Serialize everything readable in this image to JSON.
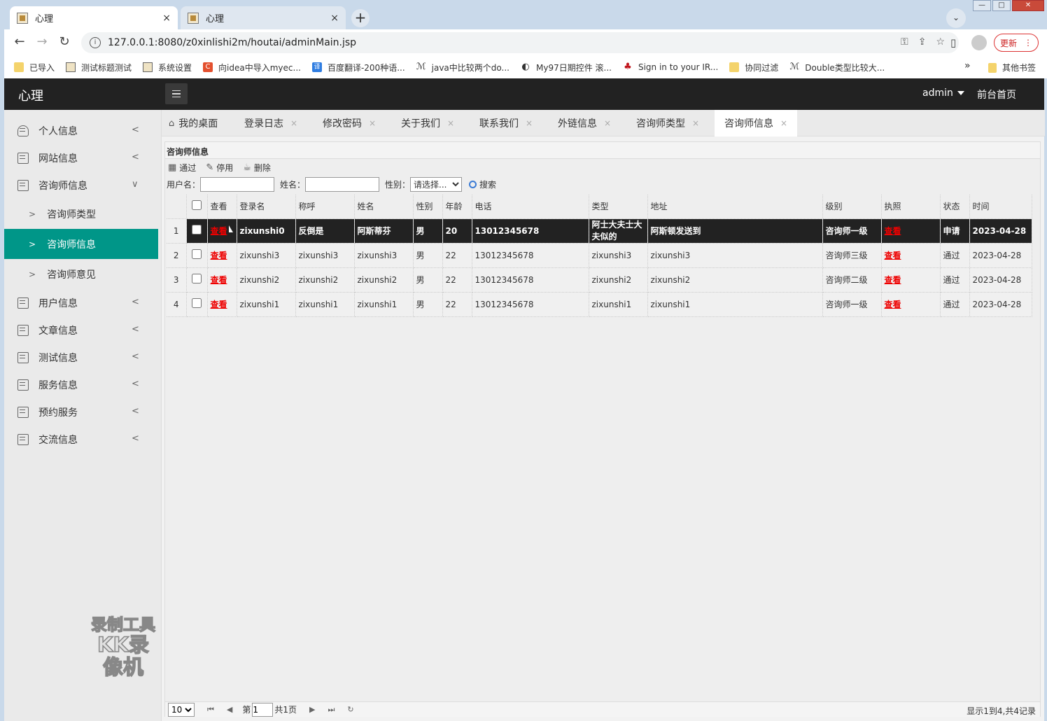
{
  "browser": {
    "tabs": [
      {
        "title": "心理",
        "close": "×"
      },
      {
        "title": "心理",
        "close": "×"
      }
    ],
    "new_tab": "+",
    "url": "127.0.0.1:8080/z0xinlishi2m/houtai/adminMain.jsp",
    "update_label": "更新",
    "bookmarks": [
      {
        "label": "已导入",
        "icon": "folder-icon"
      },
      {
        "label": "测试标题测试",
        "icon": "image-icon"
      },
      {
        "label": "系统设置",
        "icon": "image-icon"
      },
      {
        "label": "向idea中导入myec...",
        "icon": "csdn-icon"
      },
      {
        "label": "百度翻译-200种语...",
        "icon": "translate-icon"
      },
      {
        "label": "java中比较两个do...",
        "icon": "link-icon"
      },
      {
        "label": "My97日期控件 滚...",
        "icon": "globe-icon"
      },
      {
        "label": "Sign in to your IR...",
        "icon": "maple-leaf-icon"
      },
      {
        "label": "协同过滤",
        "icon": "folder-icon"
      },
      {
        "label": "Double类型比较大...",
        "icon": "link-icon"
      }
    ],
    "bookmarks_more": "»",
    "other_bookmarks": "其他书签"
  },
  "header": {
    "logo": "心理",
    "user": "admin",
    "front_link": "前台首页"
  },
  "sidebar": {
    "items": [
      {
        "label": "个人信息",
        "arrow": "<"
      },
      {
        "label": "网站信息",
        "arrow": "<"
      },
      {
        "label": "咨询师信息",
        "arrow": "∨"
      },
      {
        "label": "用户信息",
        "arrow": "<"
      },
      {
        "label": "文章信息",
        "arrow": "<"
      },
      {
        "label": "测试信息",
        "arrow": "<"
      },
      {
        "label": "服务信息",
        "arrow": "<"
      },
      {
        "label": "预约服务",
        "arrow": "<"
      },
      {
        "label": "交流信息",
        "arrow": "<"
      }
    ],
    "subitems": [
      {
        "label": "咨询师类型",
        "arrow": ">"
      },
      {
        "label": "咨询师信息",
        "arrow": ">"
      },
      {
        "label": "咨询师意见",
        "arrow": ">"
      }
    ]
  },
  "page_tabs": [
    {
      "label": "我的桌面"
    },
    {
      "label": "登录日志",
      "close": "×"
    },
    {
      "label": "修改密码",
      "close": "×"
    },
    {
      "label": "关于我们",
      "close": "×"
    },
    {
      "label": "联系我们",
      "close": "×"
    },
    {
      "label": "外链信息",
      "close": "×"
    },
    {
      "label": "咨询师类型",
      "close": "×"
    },
    {
      "label": "咨询师信息",
      "close": "×"
    }
  ],
  "panel": {
    "title": "咨询师信息",
    "ops": {
      "approve": "通过",
      "disable": "停用",
      "delete": "删除"
    },
    "filters": {
      "username_label": "用户名：",
      "name_label": "姓名：",
      "gender_label": "性别：",
      "gender_selected": "请选择...",
      "search": "搜索"
    },
    "columns": [
      "",
      "",
      "查看",
      "登录名",
      "称呼",
      "姓名",
      "性别",
      "年龄",
      "电话",
      "类型",
      "地址",
      "级别",
      "执照",
      "状态",
      "时间"
    ],
    "rows": [
      {
        "n": "1",
        "view": "查看",
        "login": "zixunshi0",
        "nick": "反倒是",
        "name": "阿斯蒂芬",
        "gender": "男",
        "age": "20",
        "phone": "13012345678",
        "type": "阿士大夫士大夫似的",
        "addr": "阿斯顿发送到",
        "level": "咨询师一级",
        "license": "查看",
        "status": "申请",
        "time": "2023-04-28"
      },
      {
        "n": "2",
        "view": "查看",
        "login": "zixunshi3",
        "nick": "zixunshi3",
        "name": "zixunshi3",
        "gender": "男",
        "age": "22",
        "phone": "13012345678",
        "type": "zixunshi3",
        "addr": "zixunshi3",
        "level": "咨询师三级",
        "license": "查看",
        "status": "通过",
        "time": "2023-04-28"
      },
      {
        "n": "3",
        "view": "查看",
        "login": "zixunshi2",
        "nick": "zixunshi2",
        "name": "zixunshi2",
        "gender": "男",
        "age": "22",
        "phone": "13012345678",
        "type": "zixunshi2",
        "addr": "zixunshi2",
        "level": "咨询师二级",
        "license": "查看",
        "status": "通过",
        "time": "2023-04-28"
      },
      {
        "n": "4",
        "view": "查看",
        "login": "zixunshi1",
        "nick": "zixunshi1",
        "name": "zixunshi1",
        "gender": "男",
        "age": "22",
        "phone": "13012345678",
        "type": "zixunshi1",
        "addr": "zixunshi1",
        "level": "咨询师一级",
        "license": "查看",
        "status": "通过",
        "time": "2023-04-28"
      }
    ],
    "pager": {
      "page_size": "10",
      "page_prefix": "第",
      "page": "1",
      "page_total": "共1页",
      "summary": "显示1到4,共4记录"
    }
  },
  "watermark": {
    "line1": "录制工具",
    "line2": "KK录像机"
  },
  "colors": {
    "accent": "#009688",
    "header_bg": "#222222",
    "link_red": "#ee0000"
  }
}
